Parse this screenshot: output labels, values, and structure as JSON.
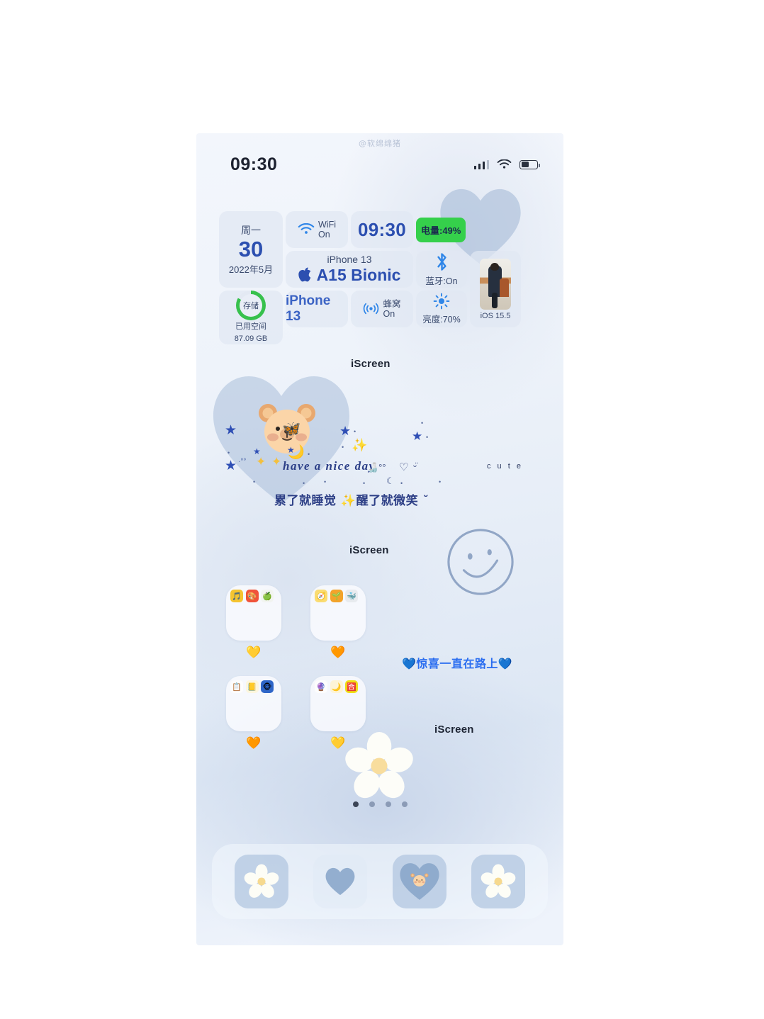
{
  "meta": {
    "watermark": "@软绵绵猪",
    "device_theme": "blue pastel iOS home screen"
  },
  "status_bar": {
    "time": "09:30",
    "signal_icon": "cellular-signal-icon",
    "wifi_icon": "wifi-icon",
    "battery_icon": "battery-icon",
    "battery_level_pct": 49
  },
  "widgets": {
    "date": {
      "weekday": "周一",
      "day": "30",
      "month_year": "2022年5月"
    },
    "storage": {
      "ring_label": "存储",
      "caption": "已用空间",
      "value": "87.09 GB"
    },
    "wifi": {
      "icon": "wifi-icon",
      "line1": "WiFi",
      "line2": "On"
    },
    "clock": {
      "time": "09:30"
    },
    "battery": {
      "text": "电量:49%",
      "pill_color": "#35d04b"
    },
    "chip": {
      "model_small": "iPhone 13",
      "apple_icon": "apple-logo-icon",
      "chip_name": "A15 Bionic"
    },
    "model": {
      "text": "iPhone 13"
    },
    "cellular": {
      "icon": "cellular-antenna-icon",
      "line1": "蜂窝",
      "line2": "On"
    },
    "bluetooth": {
      "icon": "bluetooth-icon",
      "text": "蓝牙:On"
    },
    "brightness": {
      "icon": "brightness-sun-icon",
      "text": "亮度:70%"
    },
    "photo": {
      "image_alt": "person-sitting-on-chair-photo",
      "caption": "iOS 15.5"
    }
  },
  "labels": {
    "iscreen_1": "iScreen",
    "iscreen_2": "iScreen",
    "iscreen_3": "iScreen"
  },
  "decorations": {
    "bear_face": "bear-face-sticker",
    "butterfly": "🦋",
    "moon": "🌙",
    "nice_day_text": "have a nice day",
    "cute_text": "c u t e",
    "chinese_line": "累了就睡觉  ✨醒了就微笑 ˘",
    "smiley_face": "smiley-face-outline",
    "blue_heart_line": "💙惊喜一直在路上💙",
    "flower": "white-flower-sticker"
  },
  "folders": [
    {
      "name": "folder-1",
      "heart": "💛",
      "apps": [
        "app-kugou-icon",
        "app-redbook-icon",
        "app-yellow-green-icon"
      ]
    },
    {
      "name": "folder-2",
      "heart": "🧡",
      "apps": [
        "app-compass-icon",
        "app-sprout-icon",
        "app-blue-character-icon"
      ]
    },
    {
      "name": "folder-3",
      "heart": "🧡",
      "apps": [
        "app-checklist-icon",
        "app-notes-icon",
        "app-weibo-icon"
      ]
    },
    {
      "name": "folder-4",
      "heart": "💛",
      "apps": [
        "app-gradient-circle-icon",
        "app-moon-icon",
        "app-yellow-grid-icon"
      ]
    }
  ],
  "page_indicator": {
    "total": 4,
    "active_index": 0
  },
  "dock": [
    {
      "name": "dock-app-flower-1",
      "icon": "white-flower-icon",
      "style": "tinted"
    },
    {
      "name": "dock-app-heart",
      "icon": "blue-heart-icon",
      "style": "plain"
    },
    {
      "name": "dock-app-bear",
      "icon": "bear-in-heart-icon",
      "style": "tinted"
    },
    {
      "name": "dock-app-flower-2",
      "icon": "white-flower-icon",
      "style": "tinted"
    }
  ],
  "colors": {
    "accent_blue": "#2c4fb0",
    "battery_green": "#35d04b",
    "heart_blue": "#aabdd8",
    "text_dark": "#1d2433",
    "bg_top": "#f3f6fc",
    "bg_bottom": "#dde7f4"
  }
}
